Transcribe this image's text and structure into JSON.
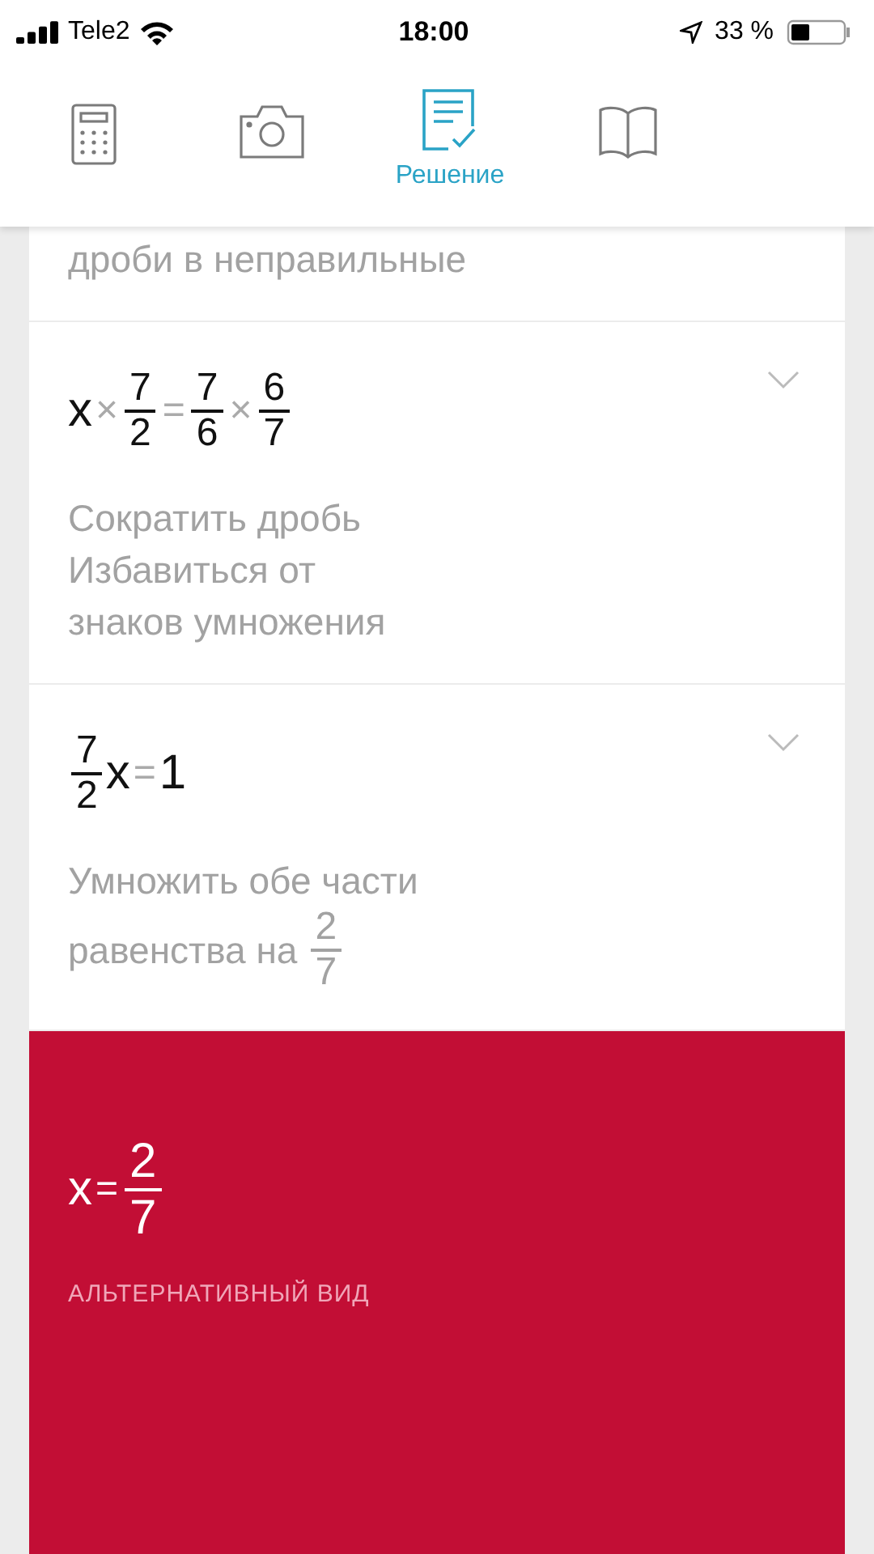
{
  "status_bar": {
    "carrier": "Tele2",
    "time": "18:00",
    "battery": "33 %"
  },
  "tabs": [
    {
      "selected": false
    },
    {
      "selected": false
    },
    {
      "selected": true,
      "label": "Решение"
    },
    {
      "selected": false
    }
  ],
  "steps": [
    {
      "lines": [
        [
          {
            "kind": "text",
            "text": "дроби в неправильные"
          }
        ]
      ]
    },
    {
      "expression": [
        {
          "kind": "var",
          "text": "x"
        },
        {
          "kind": "op",
          "text": "×"
        },
        {
          "kind": "frac",
          "num": "7",
          "den": "2"
        },
        {
          "kind": "op",
          "text": "="
        },
        {
          "kind": "frac",
          "num": "7",
          "den": "6"
        },
        {
          "kind": "op",
          "text": "×"
        },
        {
          "kind": "frac",
          "num": "6",
          "den": "7"
        }
      ],
      "lines": [
        [
          {
            "kind": "text",
            "text": "Сократить дробь"
          }
        ],
        [
          {
            "kind": "text",
            "text": "Избавиться от"
          }
        ],
        [
          {
            "kind": "text",
            "text": "знаков умножения"
          }
        ]
      ]
    },
    {
      "expression": [
        {
          "kind": "frac",
          "num": "7",
          "den": "2"
        },
        {
          "kind": "var",
          "text": "x"
        },
        {
          "kind": "op",
          "text": "="
        },
        {
          "kind": "var",
          "text": "1"
        }
      ],
      "lines": [
        [
          {
            "kind": "text",
            "text": "Умножить обе части"
          }
        ],
        [
          {
            "kind": "text",
            "text": "равенства на"
          },
          {
            "kind": "frac",
            "num": "2",
            "den": "7"
          }
        ]
      ]
    }
  ],
  "result": {
    "expression": [
      {
        "kind": "var",
        "text": "x"
      },
      {
        "kind": "op",
        "text": "="
      },
      {
        "kind": "frac",
        "num": "2",
        "den": "7"
      }
    ],
    "link": "АЛЬТЕРНАТИВНЫЙ ВИД"
  }
}
